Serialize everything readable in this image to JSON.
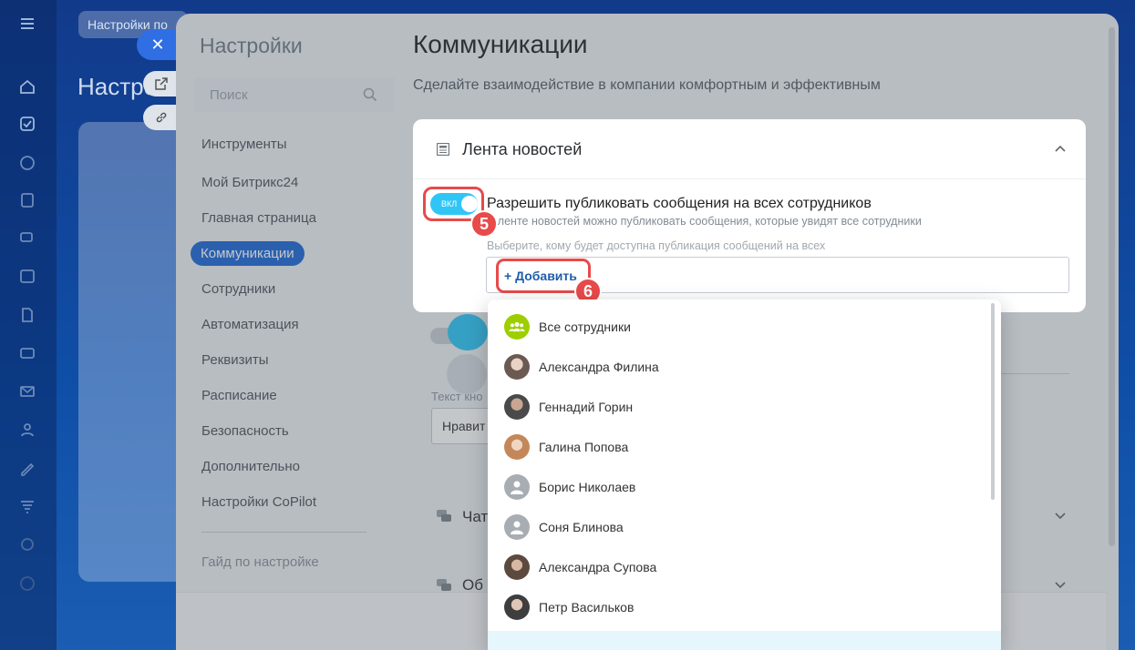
{
  "background": {
    "tab_label": "Настройки по",
    "title": "Настро",
    "nav_icons": [
      "home-icon",
      "task-icon",
      "crm-icon",
      "document-icon",
      "chat-icon",
      "calendar-icon",
      "file-icon",
      "card-icon",
      "mail-icon",
      "contacts-icon",
      "sign-icon",
      "filter-icon",
      "analytics-icon",
      "help-icon"
    ]
  },
  "slider_controls": {
    "close_glyph": "✕"
  },
  "settings": {
    "title": "Настройки",
    "search_placeholder": "Поиск",
    "menu": [
      "Инструменты",
      "Мой Битрикс24",
      "Главная страница",
      "Коммуникации",
      "Сотрудники",
      "Автоматизация",
      "Реквизиты",
      "Расписание",
      "Безопасность",
      "Дополнительно",
      "Настройки CoPilot"
    ],
    "active_item": "Коммуникации",
    "guide_link": "Гайд по настройке"
  },
  "main": {
    "title": "Коммуникации",
    "subtitle": "Сделайте взаимодействие в компании комфортным и эффективным",
    "news_card": {
      "title": "Лента новостей",
      "toggle_label": "ВКЛ",
      "option_title": "Разрешить публиковать сообщения на всех сотрудников",
      "option_desc": "В ленте новостей можно публиковать сообщения, которые увидят все сотрудники",
      "select_label": "Выберите, кому будет доступна публикация сообщений на всех",
      "add_button": "+ Добавить"
    },
    "ghost": {
      "text_label": "Текст кно",
      "input_value": "Нравит"
    },
    "chats_card": {
      "title": "Чат"
    },
    "general_card": {
      "title": "Об"
    }
  },
  "badges": {
    "step5": "5",
    "step6": "6"
  },
  "dropdown": {
    "items": [
      {
        "name": "Все сотрудники",
        "avatar": "group-icon",
        "color": "#9dcf00"
      },
      {
        "name": "Александра Филина",
        "avatar": "photo",
        "color": "#6b5a52"
      },
      {
        "name": "Геннадий Горин",
        "avatar": "photo",
        "color": "#4a4a4a"
      },
      {
        "name": "Галина Попова",
        "avatar": "photo",
        "color": "#c4875a"
      },
      {
        "name": "Борис Николаев",
        "avatar": "user-icon",
        "color": "#a8adb4"
      },
      {
        "name": "Соня Блинова",
        "avatar": "user-icon",
        "color": "#a8adb4"
      },
      {
        "name": "Александра Супова",
        "avatar": "photo",
        "color": "#5c4a3e"
      },
      {
        "name": "Петр Васильков",
        "avatar": "photo",
        "color": "#3e3e3e"
      }
    ]
  },
  "colors": {
    "accent": "#1e67d8",
    "toggle_on": "#2fc6f6",
    "highlight": "#e84a4a",
    "group_green": "#9dcf00"
  }
}
